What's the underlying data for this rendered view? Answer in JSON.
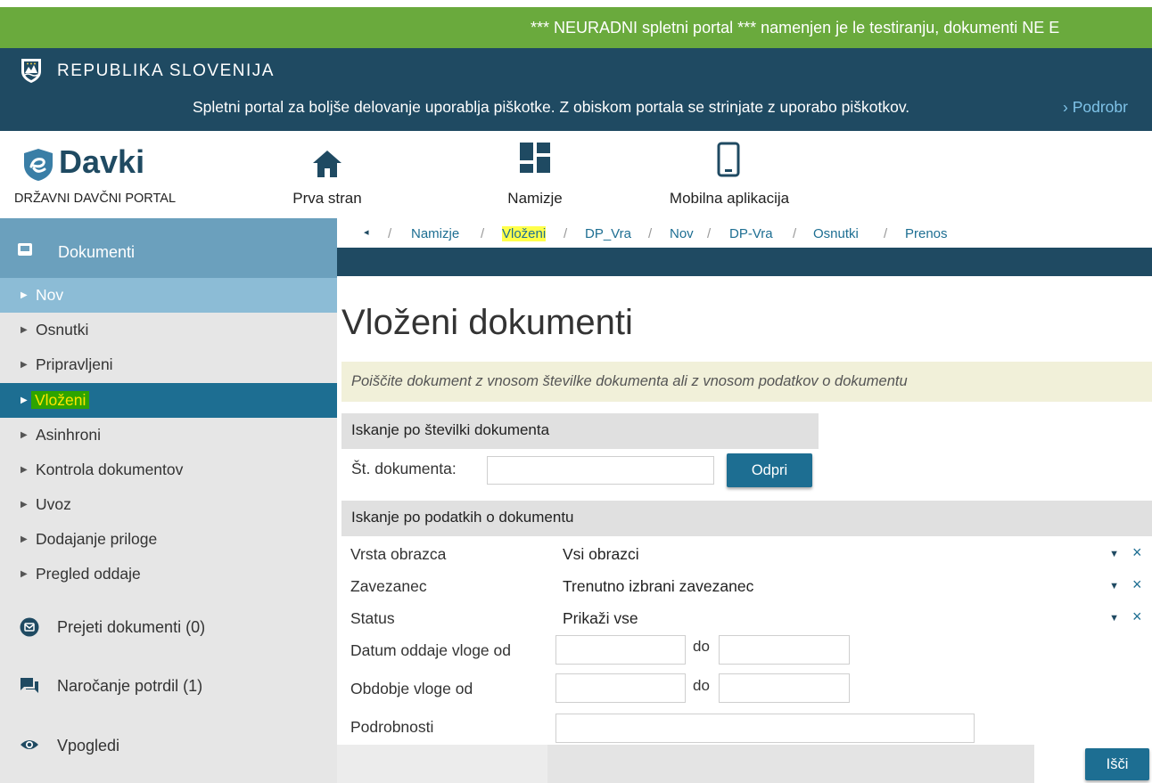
{
  "banner": {
    "text": "*** NEURADNI spletni portal *** namenjen je le testiranju, dokumenti NE E"
  },
  "gov": {
    "name": "REPUBLIKA SLOVENIJA",
    "cookie_text": "Spletni portal za boljše delovanje uporablja piškotke. Z obiskom portala se strinjate z uporabo piškotkov.",
    "cookie_link": "› Podrobr"
  },
  "brand": {
    "name": "Davki",
    "subtitle": "DRŽAVNI DAVČNI PORTAL",
    "color": "#1f4a62"
  },
  "nav": [
    {
      "label": "Prva stran",
      "icon": "home-icon"
    },
    {
      "label": "Namizje",
      "icon": "dashboard-icon"
    },
    {
      "label": "Mobilna aplikacija",
      "icon": "mobile-icon"
    }
  ],
  "sidebar": {
    "header": "Dokumenti",
    "items": [
      {
        "label": "Nov"
      },
      {
        "label": "Osnutki"
      },
      {
        "label": "Pripravljeni"
      },
      {
        "label": "Vloženi"
      },
      {
        "label": "Asinhroni"
      },
      {
        "label": "Kontrola dokumentov"
      },
      {
        "label": "Uvoz"
      },
      {
        "label": "Dodajanje priloge"
      },
      {
        "label": "Pregled oddaje"
      }
    ],
    "groups": [
      {
        "label": "Prejeti dokumenti (0)",
        "icon": "mail-icon"
      },
      {
        "label": "Naročanje potrdil (1)",
        "icon": "chat-icon"
      },
      {
        "label": "Vpogledi",
        "icon": "eye-icon"
      }
    ]
  },
  "breadcrumb": {
    "back": "◂",
    "items": [
      "Namizje",
      "Vloženi",
      "DP_Vra",
      "Nov",
      "DP-Vra",
      "Osnutki",
      "Prenos"
    ],
    "separator": "/"
  },
  "page": {
    "title": "Vloženi dokumenti",
    "info": "Poiščite dokument z vnosom številke dokumenta ali z vnosom podatkov o dokumentu"
  },
  "search_number": {
    "heading": "Iskanje po številki dokumenta",
    "label": "Št. dokumenta:",
    "value": "",
    "button": "Odpri"
  },
  "search_data": {
    "heading": "Iskanje po podatkih o dokumentu",
    "form_type": {
      "label": "Vrsta obrazca",
      "value": "Vsi obrazci"
    },
    "taxpayer": {
      "label": "Zavezanec",
      "value": "Trenutno izbrani zavezanec"
    },
    "status": {
      "label": "Status",
      "value": "Prikaži vse"
    },
    "submit_date": {
      "label": "Datum oddaje vloge od",
      "to": "do",
      "from_value": "",
      "to_value": ""
    },
    "period": {
      "label": "Obdobje vloge od",
      "to": "do",
      "from_value": "",
      "to_value": ""
    },
    "details": {
      "label": "Podrobnosti",
      "value": ""
    },
    "clear": "×",
    "caret": "▼",
    "button": "Išči"
  }
}
